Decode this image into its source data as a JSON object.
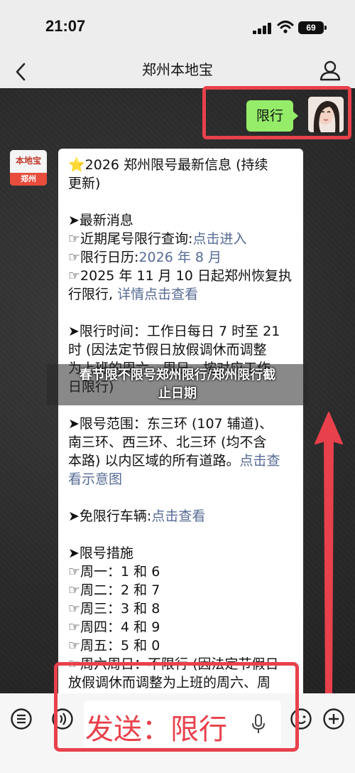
{
  "status_bar": {
    "time": "21:07",
    "battery": "69"
  },
  "nav": {
    "title": "郑州本地宝"
  },
  "outgoing": {
    "text": "限行"
  },
  "bot": {
    "logo_top": "本地宝",
    "logo_bottom": "郑州"
  },
  "message": {
    "lines": [
      {
        "segments": [
          {
            "text": "⭐",
            "style": "star"
          },
          {
            "text": "2026 郑州限号最新信息 (持续"
          }
        ]
      },
      {
        "segments": [
          {
            "text": "更新)"
          }
        ]
      },
      {
        "segments": []
      },
      {
        "segments": [
          {
            "text": "➤最新消息"
          }
        ]
      },
      {
        "segments": [
          {
            "text": "☞近期尾号限行查询:"
          },
          {
            "text": "点击进入",
            "style": "link"
          }
        ]
      },
      {
        "segments": [
          {
            "text": "☞限行日历:"
          },
          {
            "text": "2026 年 8 月",
            "style": "link"
          }
        ]
      },
      {
        "segments": [
          {
            "text": "☞2025 年 11 月 10 日起郑州恢复执"
          }
        ]
      },
      {
        "segments": [
          {
            "text": "行限行, "
          },
          {
            "text": "详情点击查看",
            "style": "link"
          }
        ]
      },
      {
        "segments": []
      },
      {
        "segments": [
          {
            "text": "➤限行时间：工作日每日 7 时至 21"
          }
        ]
      },
      {
        "segments": [
          {
            "text": "时 (因法定节假日放假调休而调整"
          }
        ]
      },
      {
        "segments": [
          {
            "text": "为上班的周六、周日，按对应工作"
          }
        ]
      },
      {
        "segments": [
          {
            "text": "日限行)"
          }
        ]
      },
      {
        "segments": []
      },
      {
        "segments": [
          {
            "text": "➤限号范围：东三环 (107 辅道)、"
          }
        ]
      },
      {
        "segments": [
          {
            "text": "南三环、西三环、北三环 (均不含"
          }
        ]
      },
      {
        "segments": [
          {
            "text": "本路) 以内区域的所有道路。"
          },
          {
            "text": "点击查",
            "style": "link"
          }
        ]
      },
      {
        "segments": [
          {
            "text": "看示意图",
            "style": "link"
          }
        ]
      },
      {
        "segments": []
      },
      {
        "segments": [
          {
            "text": "➤免限行车辆:"
          },
          {
            "text": "点击查看",
            "style": "link"
          }
        ]
      },
      {
        "segments": []
      },
      {
        "segments": [
          {
            "text": "➤限号措施"
          }
        ]
      },
      {
        "segments": [
          {
            "text": "☞周一：1 和 6"
          }
        ]
      },
      {
        "segments": [
          {
            "text": "☞周二：2 和 7"
          }
        ]
      },
      {
        "segments": [
          {
            "text": "☞周三：3 和 8"
          }
        ]
      },
      {
        "segments": [
          {
            "text": "☞周四：4 和 9"
          }
        ]
      },
      {
        "segments": [
          {
            "text": "☞周五：5 和 0"
          }
        ]
      },
      {
        "segments": [
          {
            "text": "☞周六周日：不限行 (因法定节假日"
          }
        ]
      },
      {
        "segments": [
          {
            "text": "放假调休而调整为上班的周六、周"
          }
        ]
      }
    ]
  },
  "overlay": {
    "title_line1": "春节限不限号郑州限行/郑州限行截",
    "title_line2": "止日期"
  },
  "input": {
    "text": "发送：限行"
  },
  "colors": {
    "highlight": "#e8414b",
    "link": "#576b95",
    "outgoing_bubble": "#95ec69"
  }
}
